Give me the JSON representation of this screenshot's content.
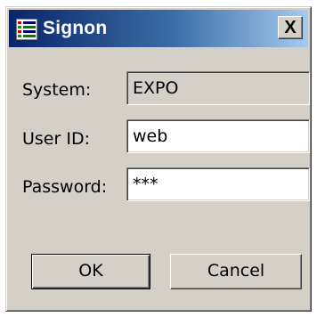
{
  "window": {
    "title": "Signon",
    "close_label": "X",
    "icon": "app-icon",
    "colors": {
      "title_start": "#0a246a",
      "title_end": "#a6caf0",
      "face": "#d4d0c8"
    }
  },
  "form": {
    "system": {
      "label": "System:",
      "value": "EXPO"
    },
    "user_id": {
      "label": "User ID:",
      "value": "web"
    },
    "password": {
      "label": "Password:",
      "value": "***"
    }
  },
  "buttons": {
    "ok": "OK",
    "cancel": "Cancel"
  }
}
